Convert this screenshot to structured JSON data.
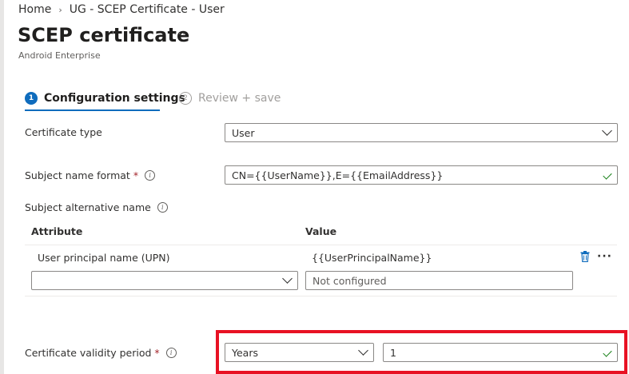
{
  "breadcrumb": {
    "home": "Home",
    "separator": "›",
    "current": "UG - SCEP Certificate - User"
  },
  "header": {
    "title": "SCEP certificate",
    "more": "···",
    "subtitle": "Android Enterprise"
  },
  "wizard": {
    "steps": [
      {
        "number": "1",
        "label": "Configuration settings",
        "active": true
      },
      {
        "number": "2",
        "label": "Review + save",
        "active": false
      }
    ]
  },
  "form": {
    "certificate_type": {
      "label": "Certificate type",
      "value": "User"
    },
    "subject_name_format": {
      "label": "Subject name format",
      "required": "*",
      "value": "CN={{UserName}},E={{EmailAddress}}"
    },
    "subject_alt_name": {
      "label": "Subject alternative name",
      "columns": {
        "attribute": "Attribute",
        "value": "Value"
      },
      "rows": [
        {
          "attribute": "User principal name (UPN)",
          "value": "{{UserPrincipalName}}"
        }
      ],
      "new_row": {
        "attribute": "",
        "value_placeholder": "Not configured"
      },
      "row_more": "···"
    },
    "validity_period": {
      "label": "Certificate validity period",
      "required": "*",
      "unit": "Years",
      "amount": "1"
    }
  },
  "colors": {
    "accent": "#0f6cbd",
    "required": "#a4262c",
    "valid_check": "#107c10",
    "highlight": "#e81123"
  },
  "icons": {
    "info": "info-icon",
    "chevron": "chevron-down-icon",
    "check": "checkmark-icon",
    "delete": "trash-icon",
    "more": "more-icon"
  }
}
